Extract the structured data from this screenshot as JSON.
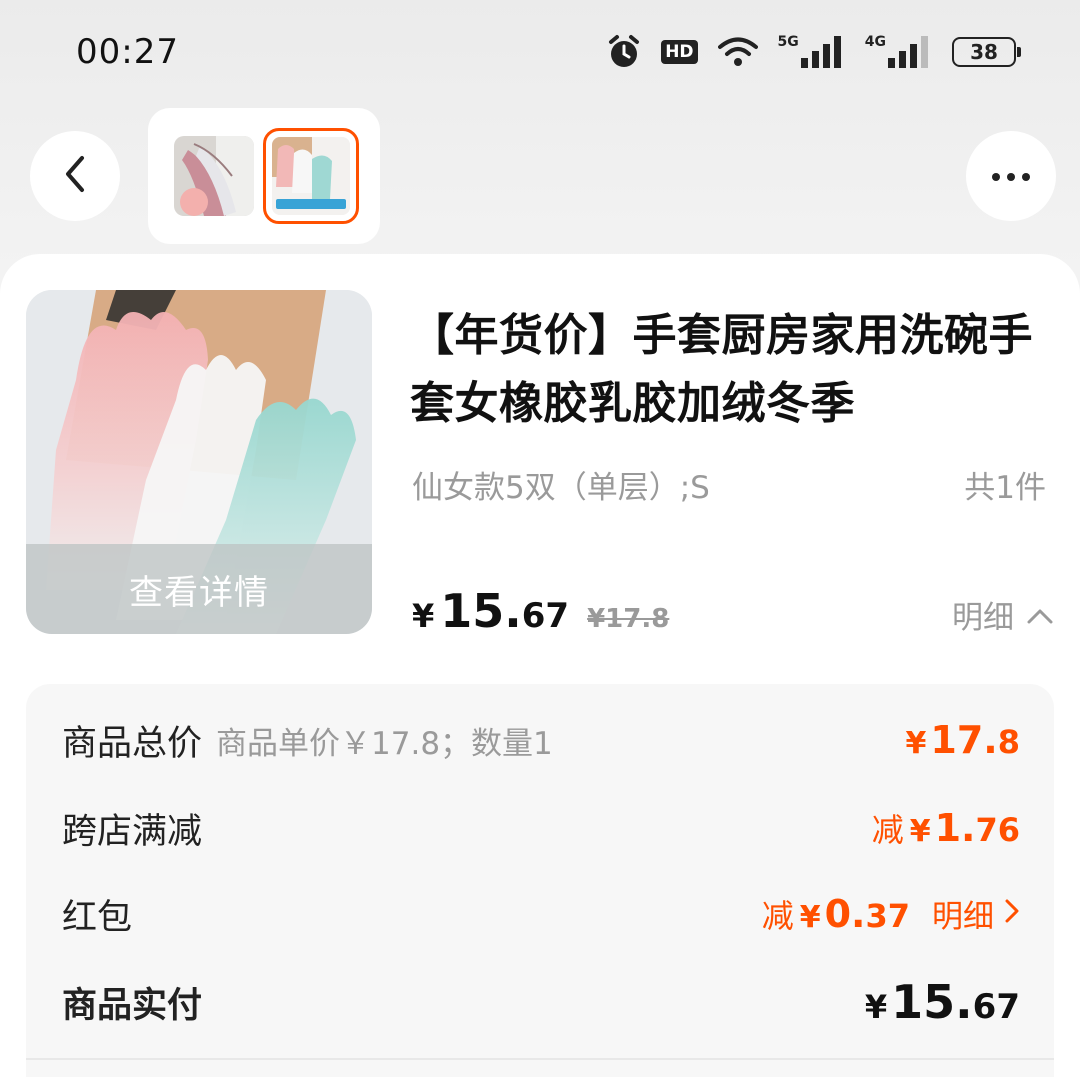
{
  "status_bar": {
    "time": "00:27",
    "hd_badge": "HD",
    "net5g": "5G",
    "net4g": "4G",
    "battery": "38"
  },
  "header": {
    "back_icon": "chevron-left-icon",
    "more_icon": "more-horizontal-icon"
  },
  "product": {
    "title": "【年货价】手套厨房家用洗碗手套女橡胶乳胶加绒冬季",
    "sku": "仙女款5双（单层）;S",
    "quantity": "共1件",
    "view_detail": "查看详情",
    "price_currency": "¥",
    "price_int": "15.",
    "price_dec": "67",
    "original_price": "¥17.8",
    "detail_toggle": "明细"
  },
  "breakdown": {
    "rows": [
      {
        "label": "商品总价",
        "sub": "商品单价￥17.8；数量1",
        "prefix": "",
        "currency": "¥",
        "int": "17.",
        "dec": "8"
      },
      {
        "label": "跨店满减",
        "sub": "",
        "prefix": "减",
        "currency": "¥",
        "int": "1.",
        "dec": "76"
      },
      {
        "label": "红包",
        "sub": "",
        "prefix": "减",
        "currency": "¥",
        "int": "0.",
        "dec": "37",
        "link": "明细"
      },
      {
        "label": "商品实付",
        "sub": "",
        "prefix": "",
        "currency": "¥",
        "int": "15.",
        "dec": "67"
      }
    ]
  },
  "colors": {
    "accent": "#ff5000",
    "muted": "#9a9a9a",
    "text": "#111111"
  }
}
